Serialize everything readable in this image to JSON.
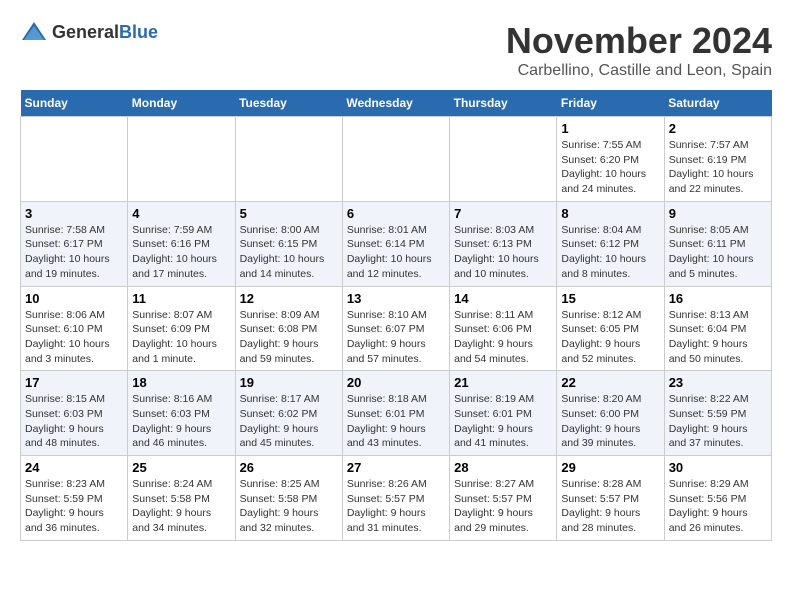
{
  "logo": {
    "general": "General",
    "blue": "Blue"
  },
  "header": {
    "month": "November 2024",
    "location": "Carbellino, Castille and Leon, Spain"
  },
  "weekdays": [
    "Sunday",
    "Monday",
    "Tuesday",
    "Wednesday",
    "Thursday",
    "Friday",
    "Saturday"
  ],
  "weeks": [
    [
      {
        "day": "",
        "content": ""
      },
      {
        "day": "",
        "content": ""
      },
      {
        "day": "",
        "content": ""
      },
      {
        "day": "",
        "content": ""
      },
      {
        "day": "",
        "content": ""
      },
      {
        "day": "1",
        "content": "Sunrise: 7:55 AM\nSunset: 6:20 PM\nDaylight: 10 hours and 24 minutes."
      },
      {
        "day": "2",
        "content": "Sunrise: 7:57 AM\nSunset: 6:19 PM\nDaylight: 10 hours and 22 minutes."
      }
    ],
    [
      {
        "day": "3",
        "content": "Sunrise: 7:58 AM\nSunset: 6:17 PM\nDaylight: 10 hours and 19 minutes."
      },
      {
        "day": "4",
        "content": "Sunrise: 7:59 AM\nSunset: 6:16 PM\nDaylight: 10 hours and 17 minutes."
      },
      {
        "day": "5",
        "content": "Sunrise: 8:00 AM\nSunset: 6:15 PM\nDaylight: 10 hours and 14 minutes."
      },
      {
        "day": "6",
        "content": "Sunrise: 8:01 AM\nSunset: 6:14 PM\nDaylight: 10 hours and 12 minutes."
      },
      {
        "day": "7",
        "content": "Sunrise: 8:03 AM\nSunset: 6:13 PM\nDaylight: 10 hours and 10 minutes."
      },
      {
        "day": "8",
        "content": "Sunrise: 8:04 AM\nSunset: 6:12 PM\nDaylight: 10 hours and 8 minutes."
      },
      {
        "day": "9",
        "content": "Sunrise: 8:05 AM\nSunset: 6:11 PM\nDaylight: 10 hours and 5 minutes."
      }
    ],
    [
      {
        "day": "10",
        "content": "Sunrise: 8:06 AM\nSunset: 6:10 PM\nDaylight: 10 hours and 3 minutes."
      },
      {
        "day": "11",
        "content": "Sunrise: 8:07 AM\nSunset: 6:09 PM\nDaylight: 10 hours and 1 minute."
      },
      {
        "day": "12",
        "content": "Sunrise: 8:09 AM\nSunset: 6:08 PM\nDaylight: 9 hours and 59 minutes."
      },
      {
        "day": "13",
        "content": "Sunrise: 8:10 AM\nSunset: 6:07 PM\nDaylight: 9 hours and 57 minutes."
      },
      {
        "day": "14",
        "content": "Sunrise: 8:11 AM\nSunset: 6:06 PM\nDaylight: 9 hours and 54 minutes."
      },
      {
        "day": "15",
        "content": "Sunrise: 8:12 AM\nSunset: 6:05 PM\nDaylight: 9 hours and 52 minutes."
      },
      {
        "day": "16",
        "content": "Sunrise: 8:13 AM\nSunset: 6:04 PM\nDaylight: 9 hours and 50 minutes."
      }
    ],
    [
      {
        "day": "17",
        "content": "Sunrise: 8:15 AM\nSunset: 6:03 PM\nDaylight: 9 hours and 48 minutes."
      },
      {
        "day": "18",
        "content": "Sunrise: 8:16 AM\nSunset: 6:03 PM\nDaylight: 9 hours and 46 minutes."
      },
      {
        "day": "19",
        "content": "Sunrise: 8:17 AM\nSunset: 6:02 PM\nDaylight: 9 hours and 45 minutes."
      },
      {
        "day": "20",
        "content": "Sunrise: 8:18 AM\nSunset: 6:01 PM\nDaylight: 9 hours and 43 minutes."
      },
      {
        "day": "21",
        "content": "Sunrise: 8:19 AM\nSunset: 6:01 PM\nDaylight: 9 hours and 41 minutes."
      },
      {
        "day": "22",
        "content": "Sunrise: 8:20 AM\nSunset: 6:00 PM\nDaylight: 9 hours and 39 minutes."
      },
      {
        "day": "23",
        "content": "Sunrise: 8:22 AM\nSunset: 5:59 PM\nDaylight: 9 hours and 37 minutes."
      }
    ],
    [
      {
        "day": "24",
        "content": "Sunrise: 8:23 AM\nSunset: 5:59 PM\nDaylight: 9 hours and 36 minutes."
      },
      {
        "day": "25",
        "content": "Sunrise: 8:24 AM\nSunset: 5:58 PM\nDaylight: 9 hours and 34 minutes."
      },
      {
        "day": "26",
        "content": "Sunrise: 8:25 AM\nSunset: 5:58 PM\nDaylight: 9 hours and 32 minutes."
      },
      {
        "day": "27",
        "content": "Sunrise: 8:26 AM\nSunset: 5:57 PM\nDaylight: 9 hours and 31 minutes."
      },
      {
        "day": "28",
        "content": "Sunrise: 8:27 AM\nSunset: 5:57 PM\nDaylight: 9 hours and 29 minutes."
      },
      {
        "day": "29",
        "content": "Sunrise: 8:28 AM\nSunset: 5:57 PM\nDaylight: 9 hours and 28 minutes."
      },
      {
        "day": "30",
        "content": "Sunrise: 8:29 AM\nSunset: 5:56 PM\nDaylight: 9 hours and 26 minutes."
      }
    ]
  ]
}
